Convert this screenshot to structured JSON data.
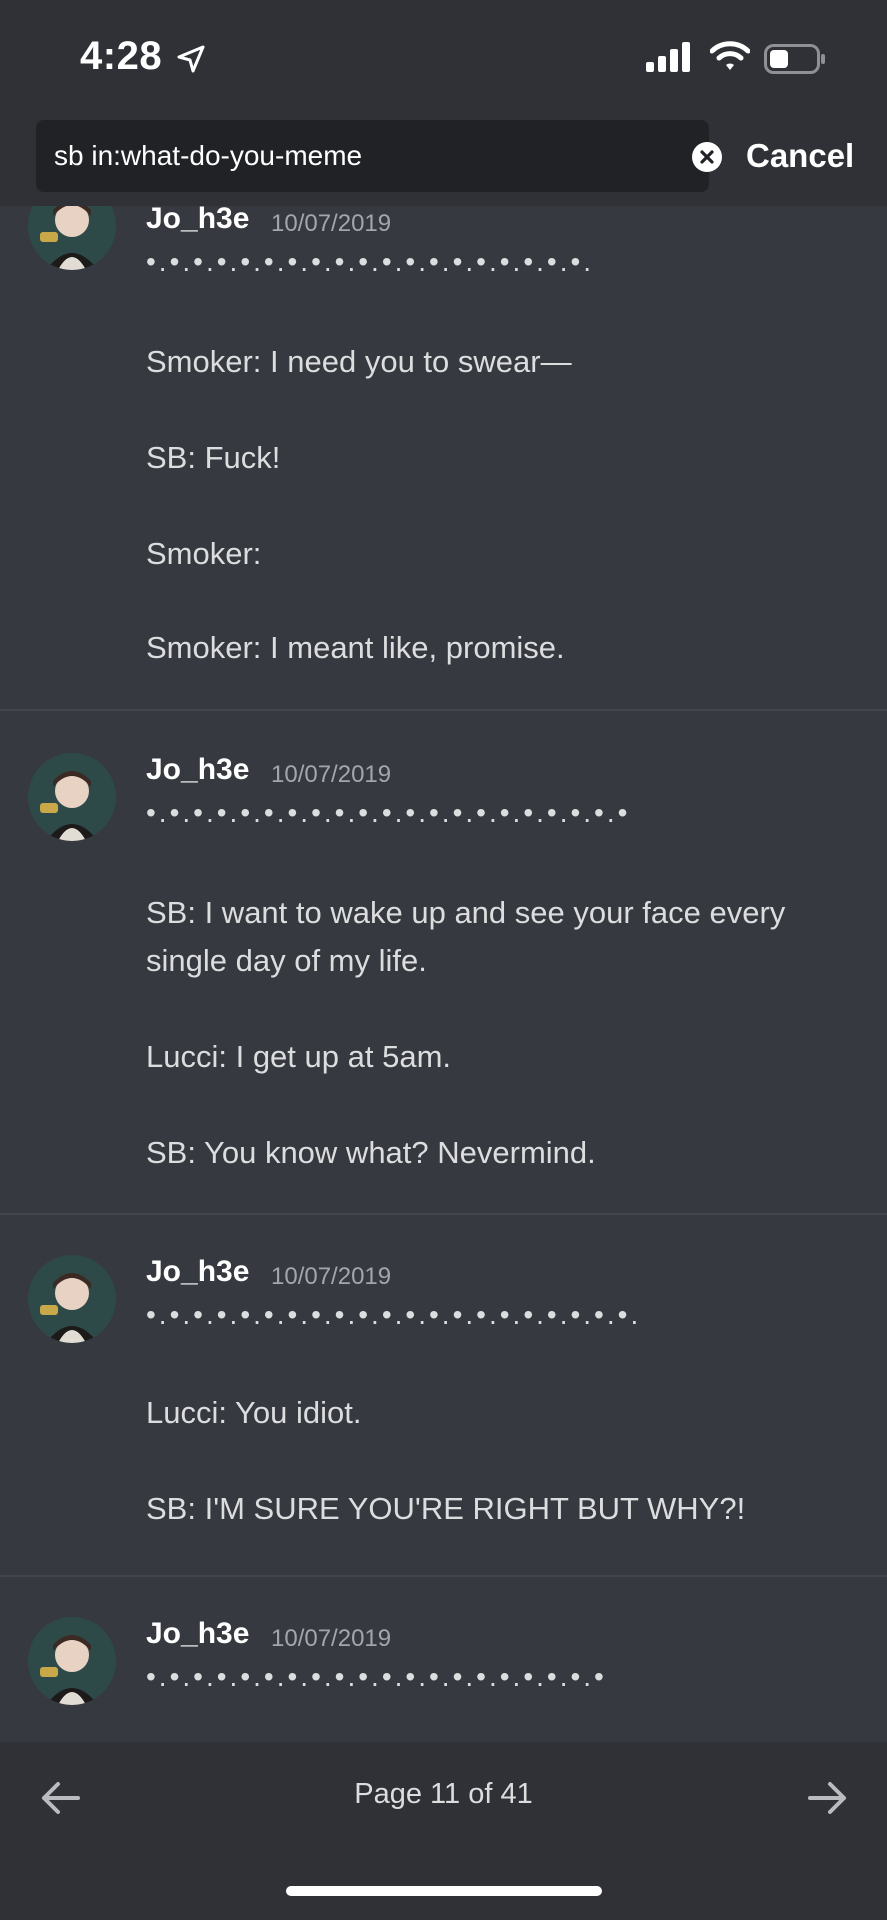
{
  "status_bar": {
    "time": "4:28"
  },
  "search": {
    "query": "sb in:what-do-you-meme",
    "cancel_label": "Cancel"
  },
  "messages": [
    {
      "author": "Jo_h3e",
      "date": "10/07/2019",
      "decoration": "•.•.•.•.•.•.•.•.•.•.•.•.•.•.•.•.•.•.•.",
      "lines": [
        "Smoker: I need you to swear—",
        "SB: Fuck!",
        "Smoker:",
        "Smoker: I meant like, promise."
      ]
    },
    {
      "author": "Jo_h3e",
      "date": "10/07/2019",
      "decoration": "•.•.•.•.•.•.•.•.•.•.•.•.•.•.•.•.•.•.•.•.•",
      "lines": [
        "SB: I want to wake up and see your face every",
        "single day of my life.",
        "Lucci: I get up at 5am.",
        "SB: You know what? Nevermind."
      ]
    },
    {
      "author": "Jo_h3e",
      "date": "10/07/2019",
      "decoration": "•.•.•.•.•.•.•.•.•.•.•.•.•.•.•.•.•.•.•.•.•.",
      "lines": [
        "Lucci: You idiot.",
        "SB: I'M SURE YOU'RE RIGHT BUT WHY?!"
      ]
    },
    {
      "author": "Jo_h3e",
      "date": "10/07/2019",
      "decoration": "•.•.•.•.•.•.•.•.•.•.•.•.•.•.•.•.•.•.•.•",
      "lines": []
    }
  ],
  "pager": {
    "label": "Page 11 of 41"
  },
  "colors": {
    "background": "#36393f",
    "header": "#2f3136",
    "input": "#202225",
    "timestamp": "#a3a6aa"
  }
}
